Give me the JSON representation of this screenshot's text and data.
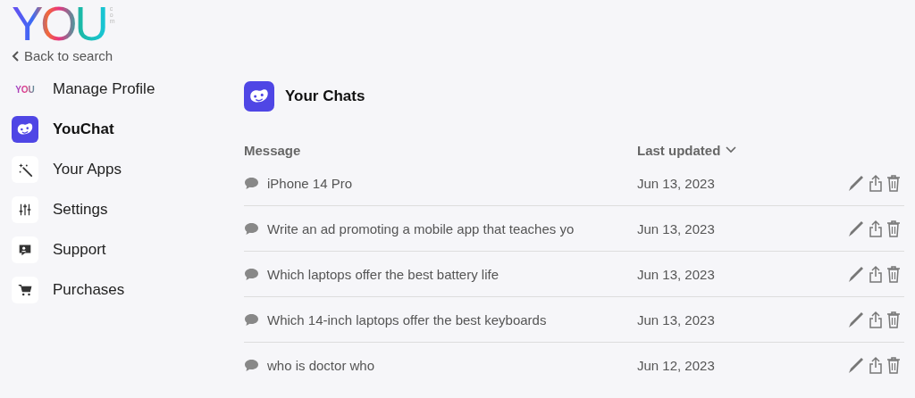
{
  "logo": {
    "text": "YOU",
    "suffix": "com"
  },
  "back_link": {
    "label": "Back to search"
  },
  "sidebar": {
    "items": [
      {
        "label": "Manage Profile",
        "kind": "logo",
        "icon_text": "YOU",
        "selected": false
      },
      {
        "label": "YouChat",
        "kind": "chat",
        "selected": true
      },
      {
        "label": "Your Apps",
        "kind": "apps",
        "selected": false
      },
      {
        "label": "Settings",
        "kind": "settings",
        "selected": false
      },
      {
        "label": "Support",
        "kind": "support",
        "selected": false
      },
      {
        "label": "Purchases",
        "kind": "cart",
        "selected": false
      }
    ]
  },
  "page": {
    "title": "Your Chats"
  },
  "table": {
    "columns": [
      {
        "label": "Message",
        "sortable": false
      },
      {
        "label": "Last updated",
        "sortable": true
      }
    ],
    "rows": [
      {
        "message": "iPhone 14 Pro",
        "date": "Jun 13, 2023"
      },
      {
        "message": "Write an ad promoting a mobile app that teaches yo",
        "date": "Jun 13, 2023"
      },
      {
        "message": "Which laptops offer the best battery life",
        "date": "Jun 13, 2023"
      },
      {
        "message": "Which 14-inch laptops offer the best keyboards",
        "date": "Jun 13, 2023"
      },
      {
        "message": "who is doctor who",
        "date": "Jun 12, 2023"
      }
    ]
  }
}
